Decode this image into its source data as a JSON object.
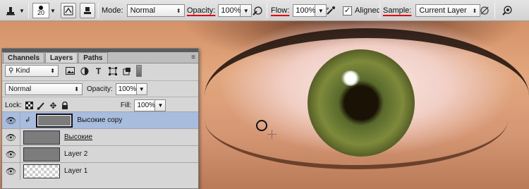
{
  "toolbar": {
    "brush_size": "20",
    "mode_label": "Mode:",
    "mode_value": "Normal",
    "opacity_label": "Opacity:",
    "opacity_value": "100%",
    "flow_label": "Flow:",
    "flow_value": "100%",
    "aligned_label": "Aligned",
    "aligned_checked": "✓",
    "sample_label": "Sample:",
    "sample_value": "Current Layer",
    "icons": [
      "clone-stamp-tool-icon",
      "brush-preset-icon",
      "clone-source-panel-icon",
      "toggle-brush-panel-icon",
      "pressure-opacity-icon",
      "airbrush-icon",
      "ignore-adjustment-icon",
      "pressure-size-icon"
    ]
  },
  "layers_panel": {
    "tabs": [
      "Channels",
      "Layers",
      "Paths"
    ],
    "active_tab": "Layers",
    "menu_glyph": "≡",
    "filter_kind": "Kind",
    "blend_mode": "Normal",
    "opacity_label": "Opacity:",
    "opacity_value": "100%",
    "lock_label": "Lock:",
    "fill_label": "Fill:",
    "fill_value": "100%",
    "layers": [
      {
        "name": "Высокие copy",
        "selected": true,
        "clipped": true
      },
      {
        "name": "Высокие",
        "selected": false
      },
      {
        "name": "Layer 2",
        "selected": false
      },
      {
        "name": "Layer 1",
        "selected": false
      }
    ]
  },
  "colors": {
    "annotation_underline": "#e00000",
    "selected_layer": "#a8bddd",
    "panel_bg": "#d6d6d6"
  }
}
